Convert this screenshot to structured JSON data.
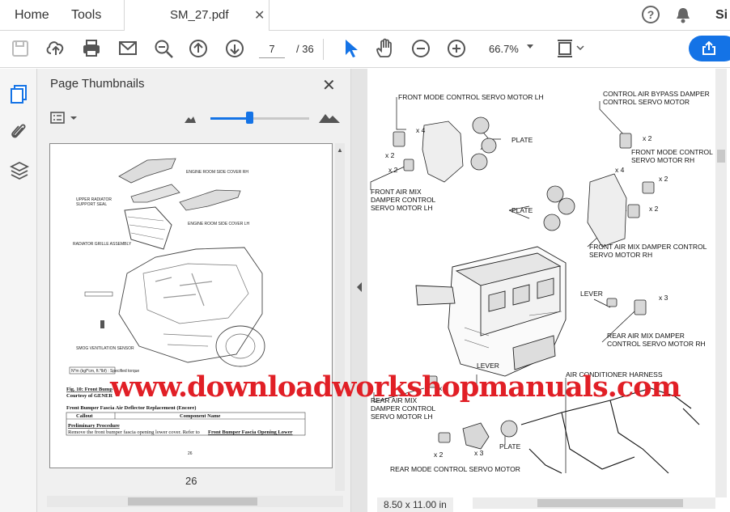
{
  "tabs": {
    "home": "Home",
    "tools": "Tools",
    "document": "SM_27.pdf",
    "signin": "Si"
  },
  "toolbar": {
    "page_current": "7",
    "page_total": "/ 36",
    "zoom": "66.7%",
    "icons": [
      "save-icon",
      "upload-icon",
      "print-icon",
      "email-icon",
      "zoom-search-icon",
      "prev-page-icon",
      "next-page-icon",
      "select-arrow-icon",
      "hand-icon",
      "zoom-out-icon",
      "zoom-in-icon",
      "fit-page-icon",
      "share-icon"
    ]
  },
  "thumbnails": {
    "title": "Page Thumbnails",
    "page_number": "26",
    "thumb": {
      "labels": {
        "engine_cover_rh": "ENGINE ROOM SIDE COVER RH",
        "upper_radiator": "UPPER RADIATOR",
        "support_seal": "SUPPORT SEAL",
        "engine_cover_lh": "ENGINE ROOM SIDE COVER LH",
        "grille": "RADIATOR GRILLE ASSEMBLY",
        "smog": "SMOG VENTILATION SENSOR",
        "torque": "N*m (kgf*cm, ft.*lbf) : Specified torque",
        "fig": "Fig. 10: Front Bump",
        "courtesy": "Courtesy of GENER",
        "section": "Front Bumper Fascia Air Deflector Replacement (Encore)",
        "col_callout": "Callout",
        "col_component": "Component Name",
        "prelim": "Preliminary Procedure",
        "remove": "Remove the front bumper fascia opening lower cover. Refer to",
        "link": "Front Bumper Fascia Opening Lower",
        "page": "26"
      }
    }
  },
  "document": {
    "page_size": "8.50 x 11.00 in",
    "labels": {
      "front_mode_lh": "FRONT MODE CONTROL SERVO MOTOR LH",
      "bypass_1": "CONTROL AIR BYPASS DAMPER",
      "bypass_2": "CONTROL SERVO MOTOR",
      "plate_1": "PLATE",
      "front_mode_rh_1": "FRONT MODE CONTROL",
      "front_mode_rh_2": "SERVO MOTOR RH",
      "front_mix_lh_1": "FRONT AIR MIX",
      "front_mix_lh_2": "DAMPER CONTROL",
      "front_mix_lh_3": "SERVO MOTOR LH",
      "plate_2": "PLATE",
      "front_mix_rh_1": "FRONT AIR MIX DAMPER CONTROL",
      "front_mix_rh_2": "SERVO MOTOR RH",
      "lever_1": "LEVER",
      "rear_mix_rh_1": "REAR AIR MIX DAMPER",
      "rear_mix_rh_2": "CONTROL SERVO MOTOR RH",
      "lever_2": "LEVER",
      "harness": "AIR CONDITIONER HARNESS",
      "rear_mix_lh_1": "REAR AIR MIX",
      "rear_mix_lh_2": "DAMPER CONTROL",
      "rear_mix_lh_3": "SERVO MOTOR LH",
      "plate_3": "PLATE",
      "rear_mode": "REAR MODE CONTROL SERVO MOTOR",
      "x2a": "x 2",
      "x4a": "x 4",
      "x2b": "x 2",
      "x2c": "x 2",
      "x2d": "x 2",
      "x4b": "x 4",
      "x2e": "x 2",
      "x3a": "x 3",
      "x4c": "x 4",
      "x3b": "x 3",
      "x2f": "x 2"
    }
  },
  "watermark": "www.downloadworkshopmanuals.com",
  "colors": {
    "accent": "#1473e6",
    "watermark": "#e11f26"
  }
}
